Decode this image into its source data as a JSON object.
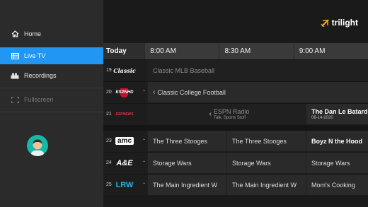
{
  "sidebar": {
    "items": [
      {
        "label": "Home",
        "icon": "home-icon"
      },
      {
        "label": "Live TV",
        "icon": "tv-guide-icon"
      },
      {
        "label": "Recordings",
        "icon": "recordings-icon"
      },
      {
        "label": "Fullscreen",
        "icon": "fullscreen-icon"
      }
    ],
    "active_color": "#2196f3"
  },
  "brand": {
    "name": "trilight",
    "accent": "#f5a623"
  },
  "guide": {
    "day": "Today",
    "times": [
      "8:00 AM",
      "8:30 AM",
      "9:00 AM"
    ],
    "rows": [
      {
        "num": "19",
        "logo": "Classic",
        "programs": [
          "Classic MLB Baseball"
        ],
        "subs": []
      },
      {
        "num": "20",
        "logo": "ESPNHD",
        "programs": [
          "Classic College Football"
        ],
        "subs": []
      },
      {
        "num": "21",
        "logo": "ESPNEWS",
        "programs": [
          "ESPN Radio",
          "The Dan Le Batard"
        ],
        "subs": [
          "Talk, Sports Stuff",
          "08-14-2020"
        ]
      },
      {
        "num": "23",
        "logo": "amc",
        "programs": [
          "The Three Stooges",
          "The Three Stooges",
          "Boyz N the Hood"
        ],
        "subs": []
      },
      {
        "num": "24",
        "logo": "A&E",
        "programs": [
          "Storage Wars",
          "Storage Wars",
          "Storage Wars"
        ],
        "subs": []
      },
      {
        "num": "25",
        "logo": "LRW",
        "programs": [
          "The Main Ingredient W",
          "The Main Ingredient W",
          "Mom's Cooking"
        ],
        "subs": []
      }
    ]
  }
}
